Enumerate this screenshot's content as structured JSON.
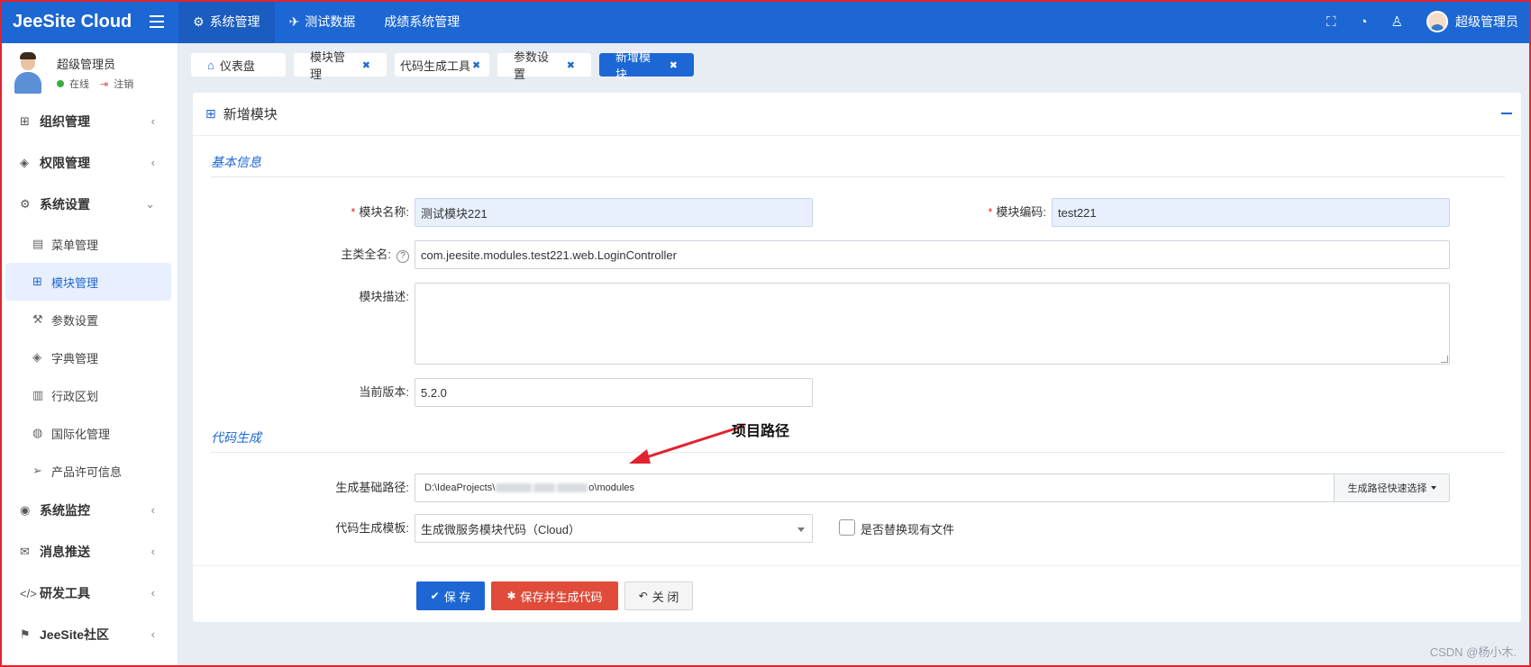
{
  "app": {
    "brand": "JeeSite Cloud",
    "topnav": [
      {
        "label": "系统管理",
        "icon": "gear-icon",
        "glyph": "⚙",
        "active": true
      },
      {
        "label": "测试数据",
        "icon": "rocket-icon",
        "glyph": "✈",
        "active": false
      },
      {
        "label": "成绩系统管理",
        "icon": "",
        "glyph": "",
        "active": false
      }
    ],
    "user_name": "超级管理员",
    "topright_icons": {
      "fullscreen": "⛶",
      "dashboard": "◔",
      "user": "♙"
    }
  },
  "profile": {
    "name": "超级管理员",
    "status": "在线",
    "logout": "注销"
  },
  "menu": {
    "org": "组织管理",
    "perm": "权限管理",
    "sys": "系统设置",
    "sub": {
      "menu": "菜单管理",
      "module": "模块管理",
      "params": "参数设置",
      "dict": "字典管理",
      "area": "行政区划",
      "i18n": "国际化管理",
      "license": "产品许可信息"
    },
    "monitor": "系统监控",
    "msg": "消息推送",
    "dev": "研发工具",
    "community": "JeeSite社区"
  },
  "tabs": {
    "dashboard": "仪表盘",
    "module": "模块管理",
    "codegen": "代码生成工具",
    "params": "参数设置",
    "new": "新增模块"
  },
  "panel": {
    "title": "新增模块",
    "section_basic": "基本信息",
    "section_codegen": "代码生成"
  },
  "form": {
    "name_label": "模块名称:",
    "name_value": "测试模块221",
    "code_label": "模块编码:",
    "code_value": "test221",
    "class_label": "主类全名:",
    "class_value": "com.jeesite.modules.test221.web.LoginController",
    "desc_label": "模块描述:",
    "version_label": "当前版本:",
    "version_value": "5.2.0",
    "path_label": "生成基础路径:",
    "path_prefix": "D:\\IdeaProjects\\",
    "path_suffix": "o\\modules",
    "path_button": "生成路径快速选择",
    "template_label": "代码生成模板:",
    "template_value": "生成微服务模块代码（Cloud）",
    "replace_label": "是否替换现有文件"
  },
  "annotation": {
    "text": "项目路径",
    "color": "#e0242f"
  },
  "buttons": {
    "save": "保 存",
    "save_gen": "保存并生成代码",
    "close": "关 闭"
  },
  "watermark": "CSDN @杨小木."
}
